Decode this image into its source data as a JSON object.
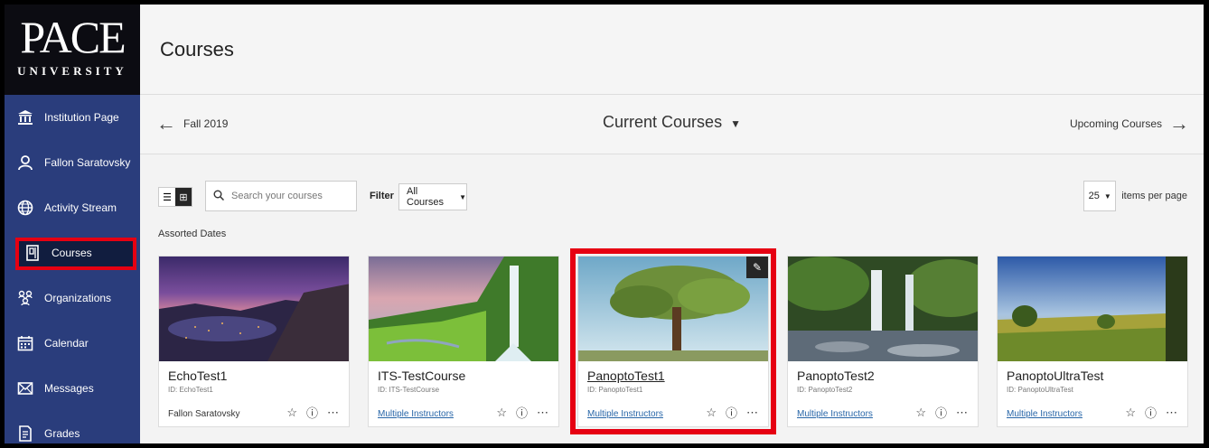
{
  "logo": {
    "main": "PACE",
    "sub": "UNIVERSITY"
  },
  "sidebar": {
    "items": [
      {
        "label": "Institution Page",
        "icon": "institution-icon"
      },
      {
        "label": "Fallon Saratovsky",
        "icon": "user-icon"
      },
      {
        "label": "Activity Stream",
        "icon": "globe-icon"
      },
      {
        "label": "Courses",
        "icon": "courses-icon",
        "active": true
      },
      {
        "label": "Organizations",
        "icon": "organizations-icon"
      },
      {
        "label": "Calendar",
        "icon": "calendar-icon"
      },
      {
        "label": "Messages",
        "icon": "messages-icon"
      },
      {
        "label": "Grades",
        "icon": "grades-icon"
      }
    ]
  },
  "header": {
    "title": "Courses"
  },
  "term": {
    "previous": "Fall 2019",
    "current": "Current Courses",
    "next": "Upcoming Courses"
  },
  "toolbar": {
    "search_placeholder": "Search your courses",
    "filter_label": "Filter",
    "filter_value": "All Courses",
    "per_page_value": "25",
    "per_page_label": "items per page"
  },
  "section": {
    "label": "Assorted Dates"
  },
  "courses": [
    {
      "title": "EchoTest1",
      "id": "ID: EchoTest1",
      "instructor": "Fallon Saratovsky",
      "instructor_link": false
    },
    {
      "title": "ITS-TestCourse",
      "id": "ID: ITS-TestCourse",
      "instructor": "Multiple Instructors",
      "instructor_link": true
    },
    {
      "title": "PanoptoTest1",
      "id": "ID: PanoptoTest1",
      "instructor": "Multiple Instructors",
      "instructor_link": true,
      "selected": true
    },
    {
      "title": "PanoptoTest2",
      "id": "ID: PanoptoTest2",
      "instructor": "Multiple Instructors",
      "instructor_link": true
    },
    {
      "title": "PanoptoUltraTest",
      "id": "ID: PanoptoUltraTest",
      "instructor": "Multiple Instructors",
      "instructor_link": true
    }
  ],
  "colors": {
    "sidebar": "#2a3d7c",
    "highlight": "#e60012",
    "link": "#2866a8"
  }
}
